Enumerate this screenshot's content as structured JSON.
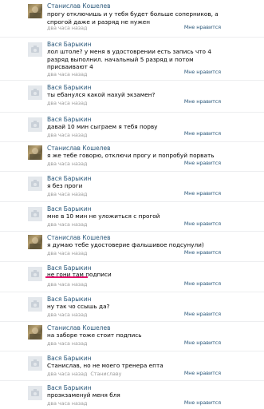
{
  "comments": [
    {
      "author": "Станислав Кошелев",
      "text": "прогу отключишь и у тебя будет больше соперников, а спрогой даже и разряд не нужен",
      "time": "два часа назад",
      "reply_to": "",
      "like": "Мне нравится",
      "avatar": "photo"
    },
    {
      "author": "Вася Барыкин",
      "text": "лол штоле? у меня в удостоврении есть запись что 4 разряд выполнил. начальный 5 разряд и потом присваивают 4",
      "time": "два часа назад",
      "reply_to": "",
      "like": "Мне нравится",
      "avatar": "camera"
    },
    {
      "author": "Вася Барыкин",
      "text": "ты ебанулся какой нахуй экзамен?",
      "time": "два часа назад",
      "reply_to": "",
      "like": "Мне нравится",
      "avatar": "camera"
    },
    {
      "author": "Вася Барыкин",
      "text": "давай 10 мин сыграем я тебя порву",
      "time": "два часа назад",
      "reply_to": "",
      "like": "Мне нравится",
      "avatar": "camera"
    },
    {
      "author": "Станислав Кошелев",
      "text": "я же тебе говорю, отключи прогу и попробуй порвать",
      "time": "два часа назад",
      "reply_to": "",
      "like": "Мне нравится",
      "avatar": "photo"
    },
    {
      "author": "Вася Барыкин",
      "text": "я без проги",
      "time": "два часа назад",
      "reply_to": "",
      "like": "Мне нравится",
      "avatar": "camera"
    },
    {
      "author": "Вася Барыкин",
      "text": "мне в 10 мин не уложиться с прогой",
      "time": "два часа назад",
      "reply_to": "",
      "like": "Мне нравится",
      "avatar": "camera"
    },
    {
      "author": "Станислав Кошелев",
      "text": "я думаю тебе удостоверие фальшивое подсунули)",
      "time": "два часа назад",
      "reply_to": "",
      "like": "Мне нравится",
      "avatar": "photo"
    },
    {
      "author": "Вася Барыкин",
      "text": "не гони там подписи",
      "time": "два часа назад",
      "reply_to": "",
      "like": "Мне нравится",
      "avatar": "camera"
    },
    {
      "author": "Вася Барыкин",
      "text": "ну так чо ссышь да?",
      "time": "два часа назад",
      "reply_to": "",
      "like": "Мне нравится",
      "avatar": "camera"
    },
    {
      "author": "Станислав Кошелев",
      "text": "на заборе тоже стоит подпись",
      "time": "два часа назад",
      "reply_to": "",
      "like": "Мне нравится",
      "avatar": "photo"
    },
    {
      "author": "Вася Барыкин",
      "text": "Станислав, но не моего тренера епта",
      "time": "два часа назад",
      "reply_to": "Станиславу",
      "like": "Мне нравится",
      "avatar": "camera"
    },
    {
      "author": "Вася Барыкин",
      "text": "проэкзаменуй меня бля",
      "time": "два часа назад",
      "reply_to": "",
      "like": "Мне нравится",
      "avatar": "camera"
    }
  ],
  "colors": {
    "author": "#2b587a",
    "meta": "#999999",
    "underline": "#e4126b"
  }
}
